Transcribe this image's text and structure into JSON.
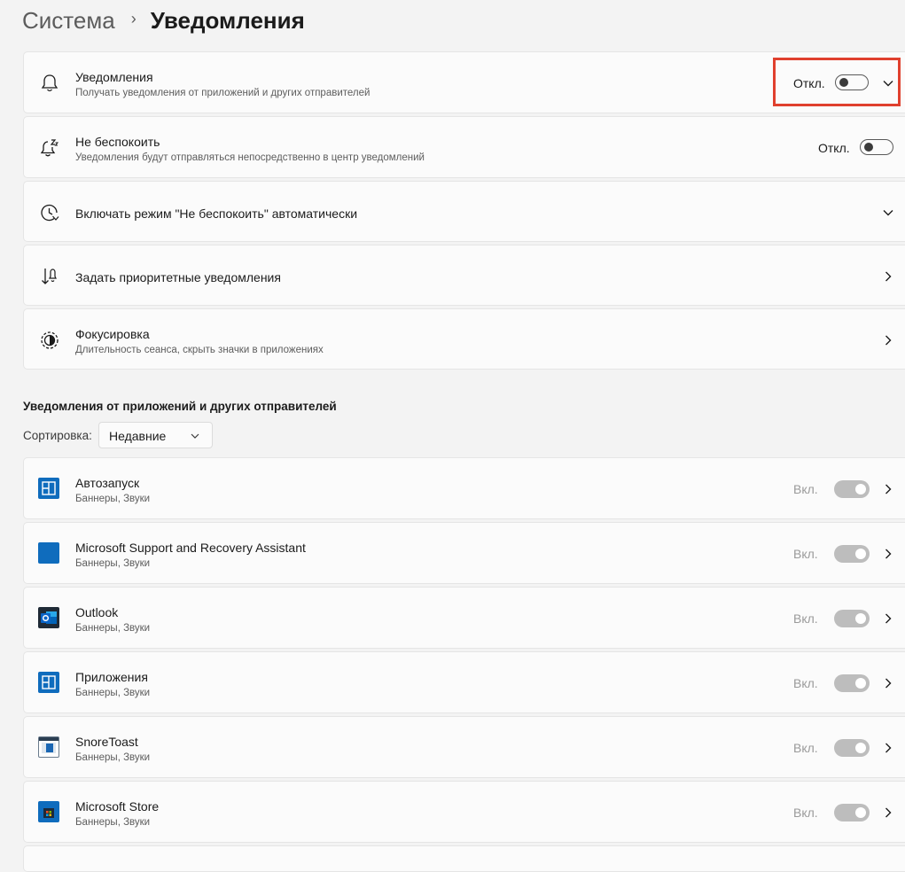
{
  "breadcrumb": {
    "parent": "Система",
    "separator": "›",
    "current": "Уведомления"
  },
  "settings": {
    "notifications": {
      "title": "Уведомления",
      "subtitle": "Получать уведомления от приложений и других отправителей",
      "state": "Откл.",
      "icon": "bell-icon"
    },
    "dnd": {
      "title": "Не беспокоить",
      "subtitle": "Уведомления будут отправляться непосредственно в центр уведомлений",
      "state": "Откл.",
      "icon": "bell-snooze-icon"
    },
    "auto_dnd": {
      "title": "Включать режим \"Не беспокоить\" автоматически",
      "icon": "clock-icon"
    },
    "priority": {
      "title": "Задать приоритетные уведомления",
      "icon": "priority-icon"
    },
    "focus": {
      "title": "Фокусировка",
      "subtitle": "Длительность сеанса, скрыть значки в приложениях",
      "icon": "focus-icon"
    }
  },
  "apps_section": {
    "title": "Уведомления от приложений и других отправителей",
    "sort_label": "Сортировка:",
    "sort_value": "Недавние"
  },
  "apps": [
    {
      "name": "Автозапуск",
      "sub": "Баннеры, Звуки",
      "state": "Вкл.",
      "icon": "autoplay-app-icon"
    },
    {
      "name": "Microsoft Support and Recovery Assistant",
      "sub": "Баннеры, Звуки",
      "state": "Вкл.",
      "icon": "sara-app-icon"
    },
    {
      "name": "Outlook",
      "sub": "Баннеры, Звуки",
      "state": "Вкл.",
      "icon": "outlook-app-icon"
    },
    {
      "name": "Приложения",
      "sub": "Баннеры, Звуки",
      "state": "Вкл.",
      "icon": "apps-app-icon"
    },
    {
      "name": "SnoreToast",
      "sub": "Баннеры, Звуки",
      "state": "Вкл.",
      "icon": "snoretoast-app-icon"
    },
    {
      "name": "Microsoft Store",
      "sub": "Баннеры, Звуки",
      "state": "Вкл.",
      "icon": "store-app-icon"
    }
  ],
  "colors": {
    "accent_blue": "#0f6cbd",
    "highlight_red": "#e0402e",
    "disabled_toggle": "#bdbdbd"
  }
}
